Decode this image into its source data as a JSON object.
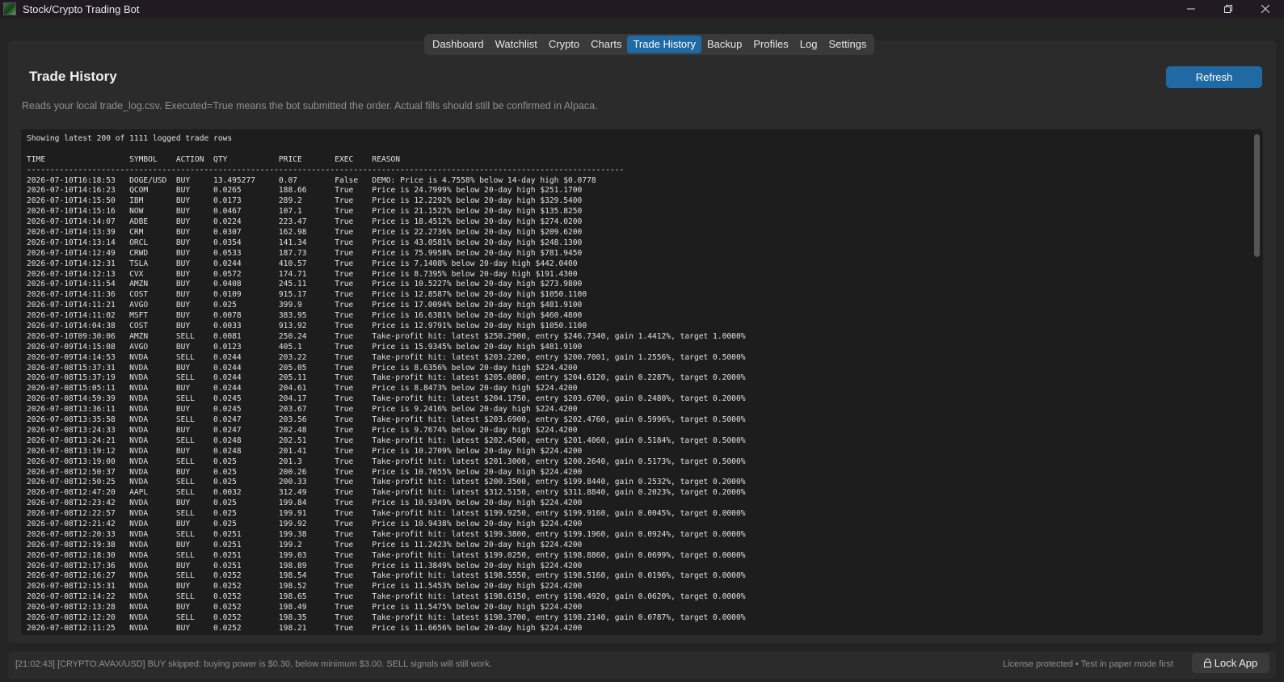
{
  "window": {
    "title": "Stock/Crypto Trading Bot",
    "icon": "app-logo-icon",
    "controls": [
      "minimize-icon",
      "restore-icon",
      "close-icon"
    ]
  },
  "tabs": [
    {
      "label": "Dashboard",
      "active": false
    },
    {
      "label": "Watchlist",
      "active": false
    },
    {
      "label": "Crypto",
      "active": false
    },
    {
      "label": "Charts",
      "active": false
    },
    {
      "label": "Trade History",
      "active": true
    },
    {
      "label": "Backup",
      "active": false
    },
    {
      "label": "Profiles",
      "active": false
    },
    {
      "label": "Log",
      "active": false
    },
    {
      "label": "Settings",
      "active": false
    }
  ],
  "page": {
    "title": "Trade History",
    "refresh_label": "Refresh",
    "subtitle": "Reads your local trade_log.csv. Executed=True means the bot submitted the order. Actual fills should still be confirmed in Alpaca."
  },
  "log": {
    "summary": "Showing latest 200 of 1111 logged trade rows",
    "headers": {
      "time": "TIME",
      "symbol": "SYMBOL",
      "action": "ACTION",
      "qty": "QTY",
      "price": "PRICE",
      "exec": "EXEC",
      "reason": "REASON"
    },
    "rows": [
      [
        "2026-07-10T16:18:53",
        "DOGE/USD",
        "BUY",
        "13.495277",
        "0.07",
        "False",
        "DEMO: Price is 4.7558% below 14-day high $0.0778"
      ],
      [
        "2026-07-10T14:16:23",
        "QCOM",
        "BUY",
        "0.0265",
        "188.66",
        "True",
        "Price is 24.7999% below 20-day high $251.1700"
      ],
      [
        "2026-07-10T14:15:50",
        "IBM",
        "BUY",
        "0.0173",
        "289.2",
        "True",
        "Price is 12.2292% below 20-day high $329.5400"
      ],
      [
        "2026-07-10T14:15:16",
        "NOW",
        "BUY",
        "0.0467",
        "107.1",
        "True",
        "Price is 21.1522% below 20-day high $135.8250"
      ],
      [
        "2026-07-10T14:14:07",
        "ADBE",
        "BUY",
        "0.0224",
        "223.47",
        "True",
        "Price is 18.4512% below 20-day high $274.0200"
      ],
      [
        "2026-07-10T14:13:39",
        "CRM",
        "BUY",
        "0.0307",
        "162.98",
        "True",
        "Price is 22.2736% below 20-day high $209.6200"
      ],
      [
        "2026-07-10T14:13:14",
        "ORCL",
        "BUY",
        "0.0354",
        "141.34",
        "True",
        "Price is 43.0581% below 20-day high $248.1300"
      ],
      [
        "2026-07-10T14:12:49",
        "CRWD",
        "BUY",
        "0.0533",
        "187.73",
        "True",
        "Price is 75.9958% below 20-day high $781.9450"
      ],
      [
        "2026-07-10T14:12:31",
        "TSLA",
        "BUY",
        "0.0244",
        "410.57",
        "True",
        "Price is 7.1408% below 20-day high $442.0400"
      ],
      [
        "2026-07-10T14:12:13",
        "CVX",
        "BUY",
        "0.0572",
        "174.71",
        "True",
        "Price is 8.7395% below 20-day high $191.4300"
      ],
      [
        "2026-07-10T14:11:54",
        "AMZN",
        "BUY",
        "0.0408",
        "245.11",
        "True",
        "Price is 10.5227% below 20-day high $273.9800"
      ],
      [
        "2026-07-10T14:11:36",
        "COST",
        "BUY",
        "0.0109",
        "915.17",
        "True",
        "Price is 12.8587% below 20-day high $1050.1100"
      ],
      [
        "2026-07-10T14:11:21",
        "AVGO",
        "BUY",
        "0.025",
        "399.9",
        "True",
        "Price is 17.0094% below 20-day high $481.9100"
      ],
      [
        "2026-07-10T14:11:02",
        "MSFT",
        "BUY",
        "0.0078",
        "383.95",
        "True",
        "Price is 16.6381% below 20-day high $460.4800"
      ],
      [
        "2026-07-10T14:04:38",
        "COST",
        "BUY",
        "0.0033",
        "913.92",
        "True",
        "Price is 12.9791% below 20-day high $1050.1100"
      ],
      [
        "2026-07-10T09:30:06",
        "AMZN",
        "SELL",
        "0.0081",
        "250.24",
        "True",
        "Take-profit hit: latest $250.2900, entry $246.7340, gain 1.4412%, target 1.0000%"
      ],
      [
        "2026-07-09T14:15:08",
        "AVGO",
        "BUY",
        "0.0123",
        "405.1",
        "True",
        "Price is 15.9345% below 20-day high $481.9100"
      ],
      [
        "2026-07-09T14:14:53",
        "NVDA",
        "SELL",
        "0.0244",
        "203.22",
        "True",
        "Take-profit hit: latest $203.2200, entry $200.7001, gain 1.2556%, target 0.5000%"
      ],
      [
        "2026-07-08T15:37:31",
        "NVDA",
        "BUY",
        "0.0244",
        "205.05",
        "True",
        "Price is 8.6356% below 20-day high $224.4200"
      ],
      [
        "2026-07-08T15:37:19",
        "NVDA",
        "SELL",
        "0.0244",
        "205.11",
        "True",
        "Take-profit hit: latest $205.0800, entry $204.6120, gain 0.2287%, target 0.2000%"
      ],
      [
        "2026-07-08T15:05:11",
        "NVDA",
        "BUY",
        "0.0244",
        "204.61",
        "True",
        "Price is 8.8473% below 20-day high $224.4200"
      ],
      [
        "2026-07-08T14:59:39",
        "NVDA",
        "SELL",
        "0.0245",
        "204.17",
        "True",
        "Take-profit hit: latest $204.1750, entry $203.6700, gain 0.2480%, target 0.2000%"
      ],
      [
        "2026-07-08T13:36:11",
        "NVDA",
        "BUY",
        "0.0245",
        "203.67",
        "True",
        "Price is 9.2416% below 20-day high $224.4200"
      ],
      [
        "2026-07-08T13:35:58",
        "NVDA",
        "SELL",
        "0.0247",
        "203.56",
        "True",
        "Take-profit hit: latest $203.6900, entry $202.4760, gain 0.5996%, target 0.5000%"
      ],
      [
        "2026-07-08T13:24:33",
        "NVDA",
        "BUY",
        "0.0247",
        "202.48",
        "True",
        "Price is 9.7674% below 20-day high $224.4200"
      ],
      [
        "2026-07-08T13:24:21",
        "NVDA",
        "SELL",
        "0.0248",
        "202.51",
        "True",
        "Take-profit hit: latest $202.4500, entry $201.4060, gain 0.5184%, target 0.5000%"
      ],
      [
        "2026-07-08T13:19:12",
        "NVDA",
        "BUY",
        "0.0248",
        "201.41",
        "True",
        "Price is 10.2709% below 20-day high $224.4200"
      ],
      [
        "2026-07-08T13:19:00",
        "NVDA",
        "SELL",
        "0.025",
        "201.3",
        "True",
        "Take-profit hit: latest $201.3000, entry $200.2640, gain 0.5173%, target 0.5000%"
      ],
      [
        "2026-07-08T12:50:37",
        "NVDA",
        "BUY",
        "0.025",
        "200.26",
        "True",
        "Price is 10.7655% below 20-day high $224.4200"
      ],
      [
        "2026-07-08T12:50:25",
        "NVDA",
        "SELL",
        "0.025",
        "200.33",
        "True",
        "Take-profit hit: latest $200.3500, entry $199.8440, gain 0.2532%, target 0.2000%"
      ],
      [
        "2026-07-08T12:47:20",
        "AAPL",
        "SELL",
        "0.0032",
        "312.49",
        "True",
        "Take-profit hit: latest $312.5150, entry $311.8840, gain 0.2023%, target 0.2000%"
      ],
      [
        "2026-07-08T12:23:42",
        "NVDA",
        "BUY",
        "0.025",
        "199.84",
        "True",
        "Price is 10.9349% below 20-day high $224.4200"
      ],
      [
        "2026-07-08T12:22:57",
        "NVDA",
        "SELL",
        "0.025",
        "199.91",
        "True",
        "Take-profit hit: latest $199.9250, entry $199.9160, gain 0.0045%, target 0.0000%"
      ],
      [
        "2026-07-08T12:21:42",
        "NVDA",
        "BUY",
        "0.025",
        "199.92",
        "True",
        "Price is 10.9438% below 20-day high $224.4200"
      ],
      [
        "2026-07-08T12:20:33",
        "NVDA",
        "SELL",
        "0.0251",
        "199.38",
        "True",
        "Take-profit hit: latest $199.3800, entry $199.1960, gain 0.0924%, target 0.0000%"
      ],
      [
        "2026-07-08T12:19:38",
        "NVDA",
        "BUY",
        "0.0251",
        "199.2",
        "True",
        "Price is 11.2423% below 20-day high $224.4200"
      ],
      [
        "2026-07-08T12:18:30",
        "NVDA",
        "SELL",
        "0.0251",
        "199.03",
        "True",
        "Take-profit hit: latest $199.0250, entry $198.8860, gain 0.0699%, target 0.0000%"
      ],
      [
        "2026-07-08T12:17:36",
        "NVDA",
        "BUY",
        "0.0251",
        "198.89",
        "True",
        "Price is 11.3849% below 20-day high $224.4200"
      ],
      [
        "2026-07-08T12:16:27",
        "NVDA",
        "SELL",
        "0.0252",
        "198.54",
        "True",
        "Take-profit hit: latest $198.5550, entry $198.5160, gain 0.0196%, target 0.0000%"
      ],
      [
        "2026-07-08T12:15:31",
        "NVDA",
        "BUY",
        "0.0252",
        "198.52",
        "True",
        "Price is 11.5453% below 20-day high $224.4200"
      ],
      [
        "2026-07-08T12:14:22",
        "NVDA",
        "SELL",
        "0.0252",
        "198.65",
        "True",
        "Take-profit hit: latest $198.6150, entry $198.4920, gain 0.0620%, target 0.0000%"
      ],
      [
        "2026-07-08T12:13:28",
        "NVDA",
        "BUY",
        "0.0252",
        "198.49",
        "True",
        "Price is 11.5475% below 20-day high $224.4200"
      ],
      [
        "2026-07-08T12:12:20",
        "NVDA",
        "SELL",
        "0.0252",
        "198.35",
        "True",
        "Take-profit hit: latest $198.3700, entry $198.2140, gain 0.0787%, target 0.0000%"
      ],
      [
        "2026-07-08T12:11:25",
        "NVDA",
        "BUY",
        "0.0252",
        "198.21",
        "True",
        "Price is 11.6656% below 20-day high $224.4200"
      ]
    ]
  },
  "status": {
    "message": "[21:02:43] [CRYPTO:AVAX/USD] BUY skipped: buying power is $0.30, below minimum $3.00. SELL signals will still work.",
    "right_text": "License protected • Test in paper mode first",
    "lock_label": "Lock App",
    "lock_icon": "lock-icon"
  }
}
